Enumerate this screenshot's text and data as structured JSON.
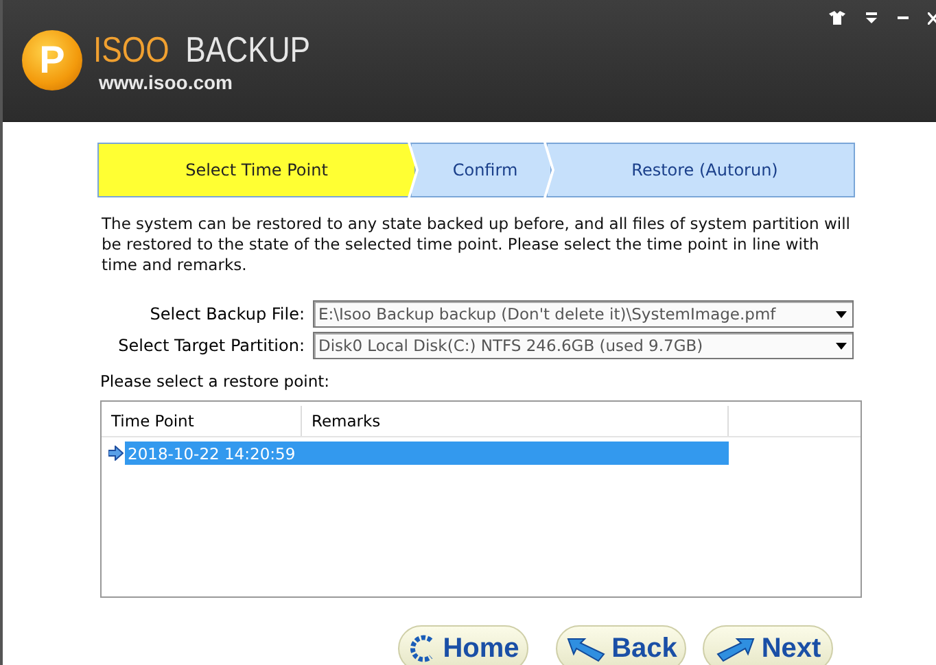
{
  "header": {
    "logo_letter": "P",
    "brand_first": "ISOO",
    "brand_second": "BACKUP",
    "url": "www.isoo.com"
  },
  "steps": [
    {
      "label": "Select Time Point",
      "selected": true
    },
    {
      "label": "Confirm",
      "selected": false
    },
    {
      "label": "Restore (Autorun)",
      "selected": false
    }
  ],
  "description": "The system can be restored to any state backed up before, and all files of system partition will be restored to the state of the selected time point. Please select the time point in line with time and remarks.",
  "fields": [
    {
      "label": "Select Backup File:",
      "value": "E:\\Isoo Backup backup (Don't delete it)\\SystemImage.pmf"
    },
    {
      "label": "Select Target Partition:",
      "value": "Disk0  Local Disk(C:) NTFS 246.6GB (used 9.7GB)"
    }
  ],
  "restore_label": "Please select a restore point:",
  "table": {
    "columns": [
      "Time Point",
      "Remarks"
    ],
    "rows": [
      {
        "time_point": "2018-10-22 14:20:59",
        "remarks": "",
        "selected": true
      }
    ]
  },
  "buttons": [
    {
      "label": "Home",
      "kind": "home"
    },
    {
      "label": "Back",
      "kind": "back"
    },
    {
      "label": "Next",
      "kind": "next"
    }
  ]
}
